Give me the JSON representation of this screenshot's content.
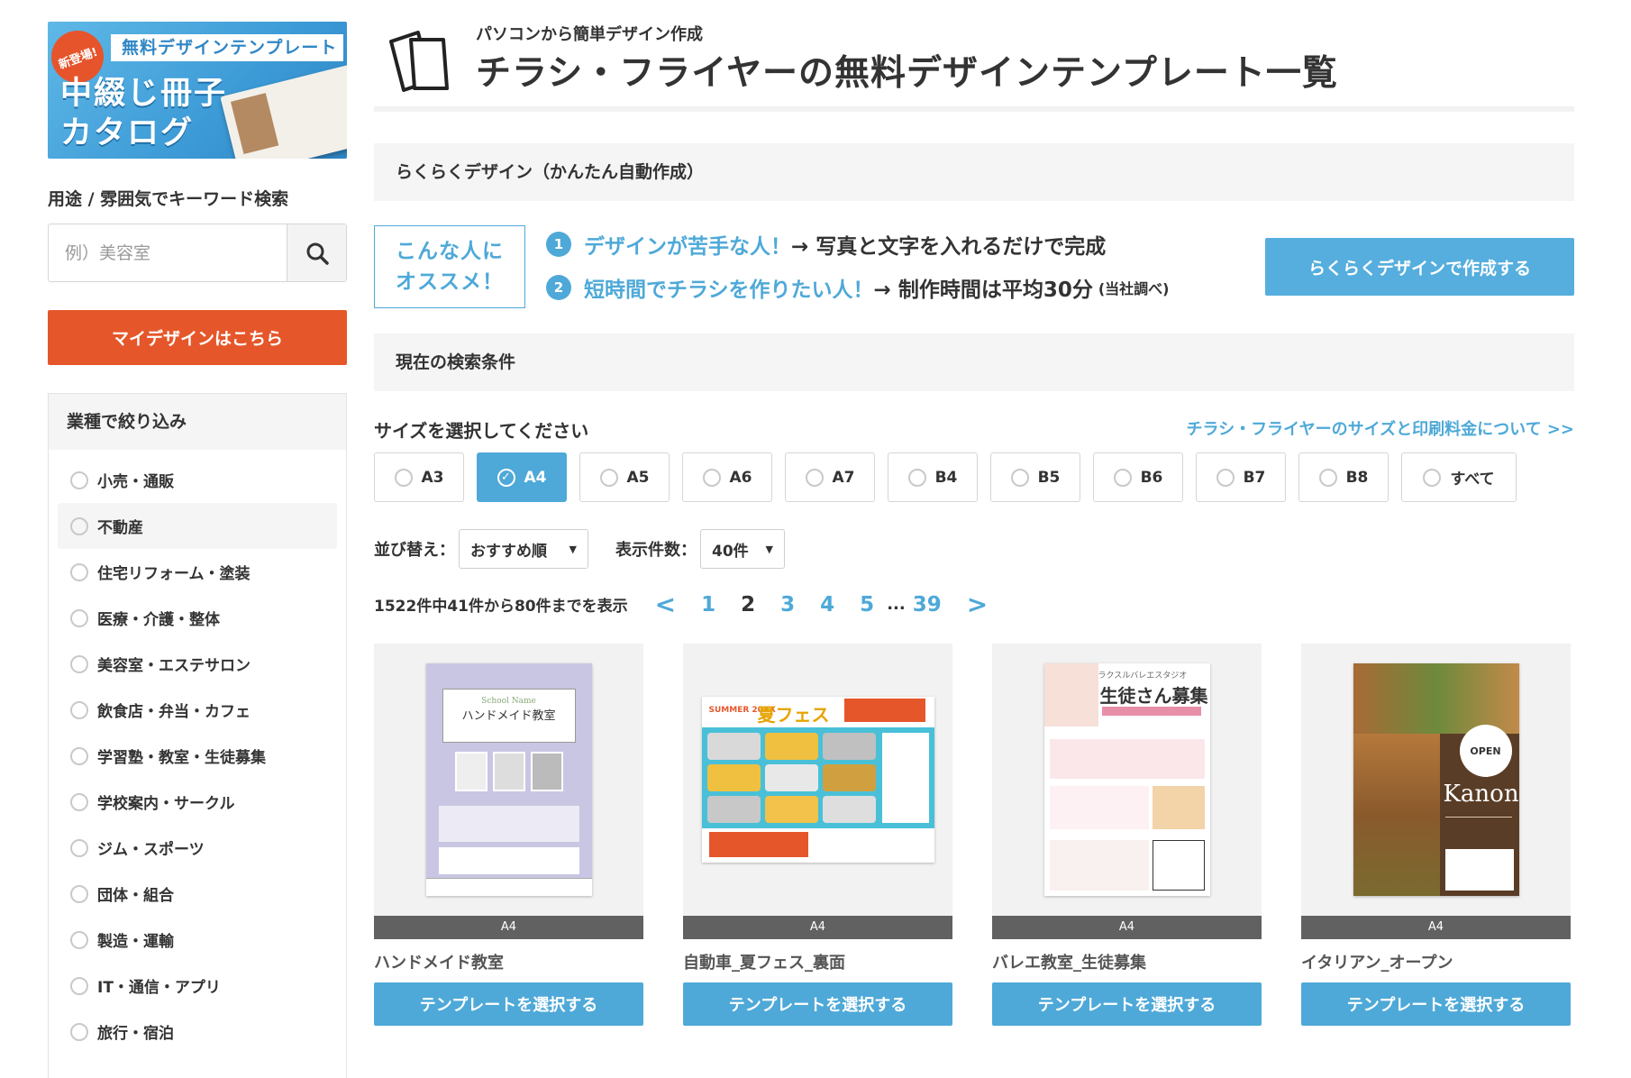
{
  "sidebar": {
    "banner": {
      "badge": "新登場!",
      "subtitle": "無料デザインテンプレート",
      "title_line1": "中綴じ冊子",
      "title_line2": "カタログ"
    },
    "search_label": "用途 / 雰囲気でキーワード検索",
    "search_placeholder": "例）美容室",
    "my_design": "マイデザインはこちら",
    "filter_title": "業種で絞り込み",
    "categories": [
      "小売・通販",
      "不動産",
      "住宅リフォーム・塗装",
      "医療・介護・整体",
      "美容室・エステサロン",
      "飲食店・弁当・カフェ",
      "学習塾・教室・生徒募集",
      "学校案内・サークル",
      "ジム・スポーツ",
      "団体・組合",
      "製造・運輸",
      "IT・通信・アプリ",
      "旅行・宿泊"
    ]
  },
  "header": {
    "pre_title": "パソコンから簡単デザイン作成",
    "title": "チラシ・フライヤーの無料デザインテンプレート一覧"
  },
  "raku": {
    "heading": "らくらくデザイン（かんたん自動作成）",
    "reco_line1": "こんな人に",
    "reco_line2": "オススメ！",
    "point1_num": "1",
    "point1_hl": "デザインが苦手な人！",
    "point1_text": "→ 写真と文字を入れるだけで完成",
    "point2_num": "2",
    "point2_hl": "短時間でチラシを作りたい人！",
    "point2_text": "→ 制作時間は平均30分",
    "point2_small": "(当社調べ)",
    "button": "らくらくデザインで作成する"
  },
  "conditions": {
    "heading": "現在の検索条件",
    "size_label": "サイズを選択してください",
    "size_link": "チラシ・フライヤーのサイズと印刷料金について >>",
    "sizes": [
      "A3",
      "A4",
      "A5",
      "A6",
      "A7",
      "B4",
      "B5",
      "B6",
      "B7",
      "B8",
      "すべて"
    ],
    "selected_size": "A4",
    "sort_label": "並び替え：",
    "sort_value": "おすすめ順",
    "count_label": "表示件数：",
    "count_value": "40件"
  },
  "pagination": {
    "summary": "1522件中41件から80件までを表示",
    "prev": "<",
    "pages": [
      "1",
      "2",
      "3",
      "4",
      "5"
    ],
    "current": "2",
    "dots": "...",
    "last": "39",
    "next": ">"
  },
  "cards": [
    {
      "size": "A4",
      "name": "ハンドメイド教室",
      "button": "テンプレートを選択する",
      "thumb_title": "ハンドメイド教室",
      "thumb_sub": "School Name"
    },
    {
      "size": "A4",
      "name": "自動車_夏フェス_裏面",
      "button": "テンプレートを選択する",
      "thumb_title": "夏フェス",
      "thumb_sub": "SUMMER 20XX"
    },
    {
      "size": "A4",
      "name": "バレエ教室_生徒募集",
      "button": "テンプレートを選択する",
      "thumb_title": "生徒さん募集",
      "thumb_sub": "ラクスルバレエスタジオ"
    },
    {
      "size": "A4",
      "name": "イタリアン_オープン",
      "button": "テンプレートを選択する",
      "thumb_title": "Kanon",
      "thumb_sub": "OPEN"
    }
  ],
  "colors": {
    "accent": "#4ea9d8",
    "orange": "#e5572a",
    "gray_bg": "#f5f5f5"
  }
}
